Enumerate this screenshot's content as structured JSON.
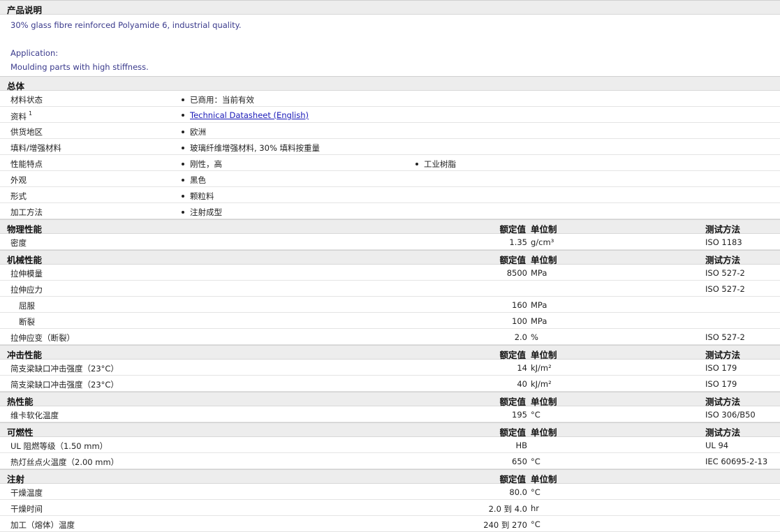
{
  "description": {
    "header": "产品说明",
    "lines": [
      "30% glass fibre reinforced Polyamide 6, industrial quality.",
      "",
      "Application:",
      "Moulding parts with high stiffness."
    ]
  },
  "general": {
    "header": "总体",
    "rows": [
      {
        "label": "材料状态",
        "sup": "",
        "items": [
          "已商用：当前有效"
        ]
      },
      {
        "label": "资料",
        "sup": "1",
        "items": [
          "Technical Datasheet (English)"
        ],
        "link": true
      },
      {
        "label": "供货地区",
        "sup": "",
        "items": [
          "欧洲"
        ]
      },
      {
        "label": "填料/增强材料",
        "sup": "",
        "items": [
          "玻璃纤维增强材料, 30% 填料按重量"
        ]
      },
      {
        "label": "性能特点",
        "sup": "",
        "items": [
          "刚性，高",
          "工业树脂"
        ]
      },
      {
        "label": "外观",
        "sup": "",
        "items": [
          "黑色"
        ]
      },
      {
        "label": "形式",
        "sup": "",
        "items": [
          "颗粒料"
        ]
      },
      {
        "label": "加工方法",
        "sup": "",
        "items": [
          "注射成型"
        ]
      }
    ]
  },
  "columns": {
    "value": "额定值",
    "unit": "单位制",
    "test": "测试方法"
  },
  "sections": [
    {
      "title": "物理性能",
      "show_test": true,
      "rows": [
        {
          "label": "密度",
          "value": "1.35",
          "unit": "g/cm³",
          "test": "ISO 1183",
          "indent": false
        }
      ]
    },
    {
      "title": "机械性能",
      "show_test": true,
      "rows": [
        {
          "label": "拉伸模量",
          "value": "8500",
          "unit": "MPa",
          "test": "ISO 527-2",
          "indent": false
        },
        {
          "label": "拉伸应力",
          "value": "",
          "unit": "",
          "test": "ISO 527-2",
          "indent": false
        },
        {
          "label": "屈服",
          "value": "160",
          "unit": "MPa",
          "test": "",
          "indent": true
        },
        {
          "label": "断裂",
          "value": "100",
          "unit": "MPa",
          "test": "",
          "indent": true
        },
        {
          "label": "拉伸应变（断裂）",
          "value": "2.0",
          "unit": "%",
          "test": "ISO 527-2",
          "indent": false
        }
      ]
    },
    {
      "title": "冲击性能",
      "show_test": true,
      "rows": [
        {
          "label": "简支梁缺口冲击强度（23°C）",
          "value": "14",
          "unit": "kJ/m²",
          "test": "ISO 179",
          "indent": false
        },
        {
          "label": "简支梁缺口冲击强度（23°C）",
          "value": "40",
          "unit": "kJ/m²",
          "test": "ISO 179",
          "indent": false
        }
      ]
    },
    {
      "title": "热性能",
      "show_test": true,
      "rows": [
        {
          "label": "维卡软化温度",
          "value": "195",
          "unit": "°C",
          "test": "ISO 306/B50",
          "indent": false
        }
      ]
    },
    {
      "title": "可燃性",
      "show_test": true,
      "rows": [
        {
          "label": "UL 阻燃等级（1.50 mm）",
          "value": "HB",
          "unit": "",
          "test": "UL 94",
          "indent": false
        },
        {
          "label": "热灯丝点火温度（2.00 mm）",
          "value": "650",
          "unit": "°C",
          "test": "IEC 60695-2-13",
          "indent": false
        }
      ]
    },
    {
      "title": "注射",
      "show_test": false,
      "rows": [
        {
          "label": "干燥温度",
          "value": "80.0",
          "unit": "°C",
          "test": "",
          "indent": false
        },
        {
          "label": "干燥时间",
          "value": "2.0 到 4.0",
          "unit": "hr",
          "test": "",
          "indent": false
        },
        {
          "label": "加工（熔体）温度",
          "value": "240 到 270",
          "unit": "°C",
          "test": "",
          "indent": false
        }
      ]
    }
  ]
}
